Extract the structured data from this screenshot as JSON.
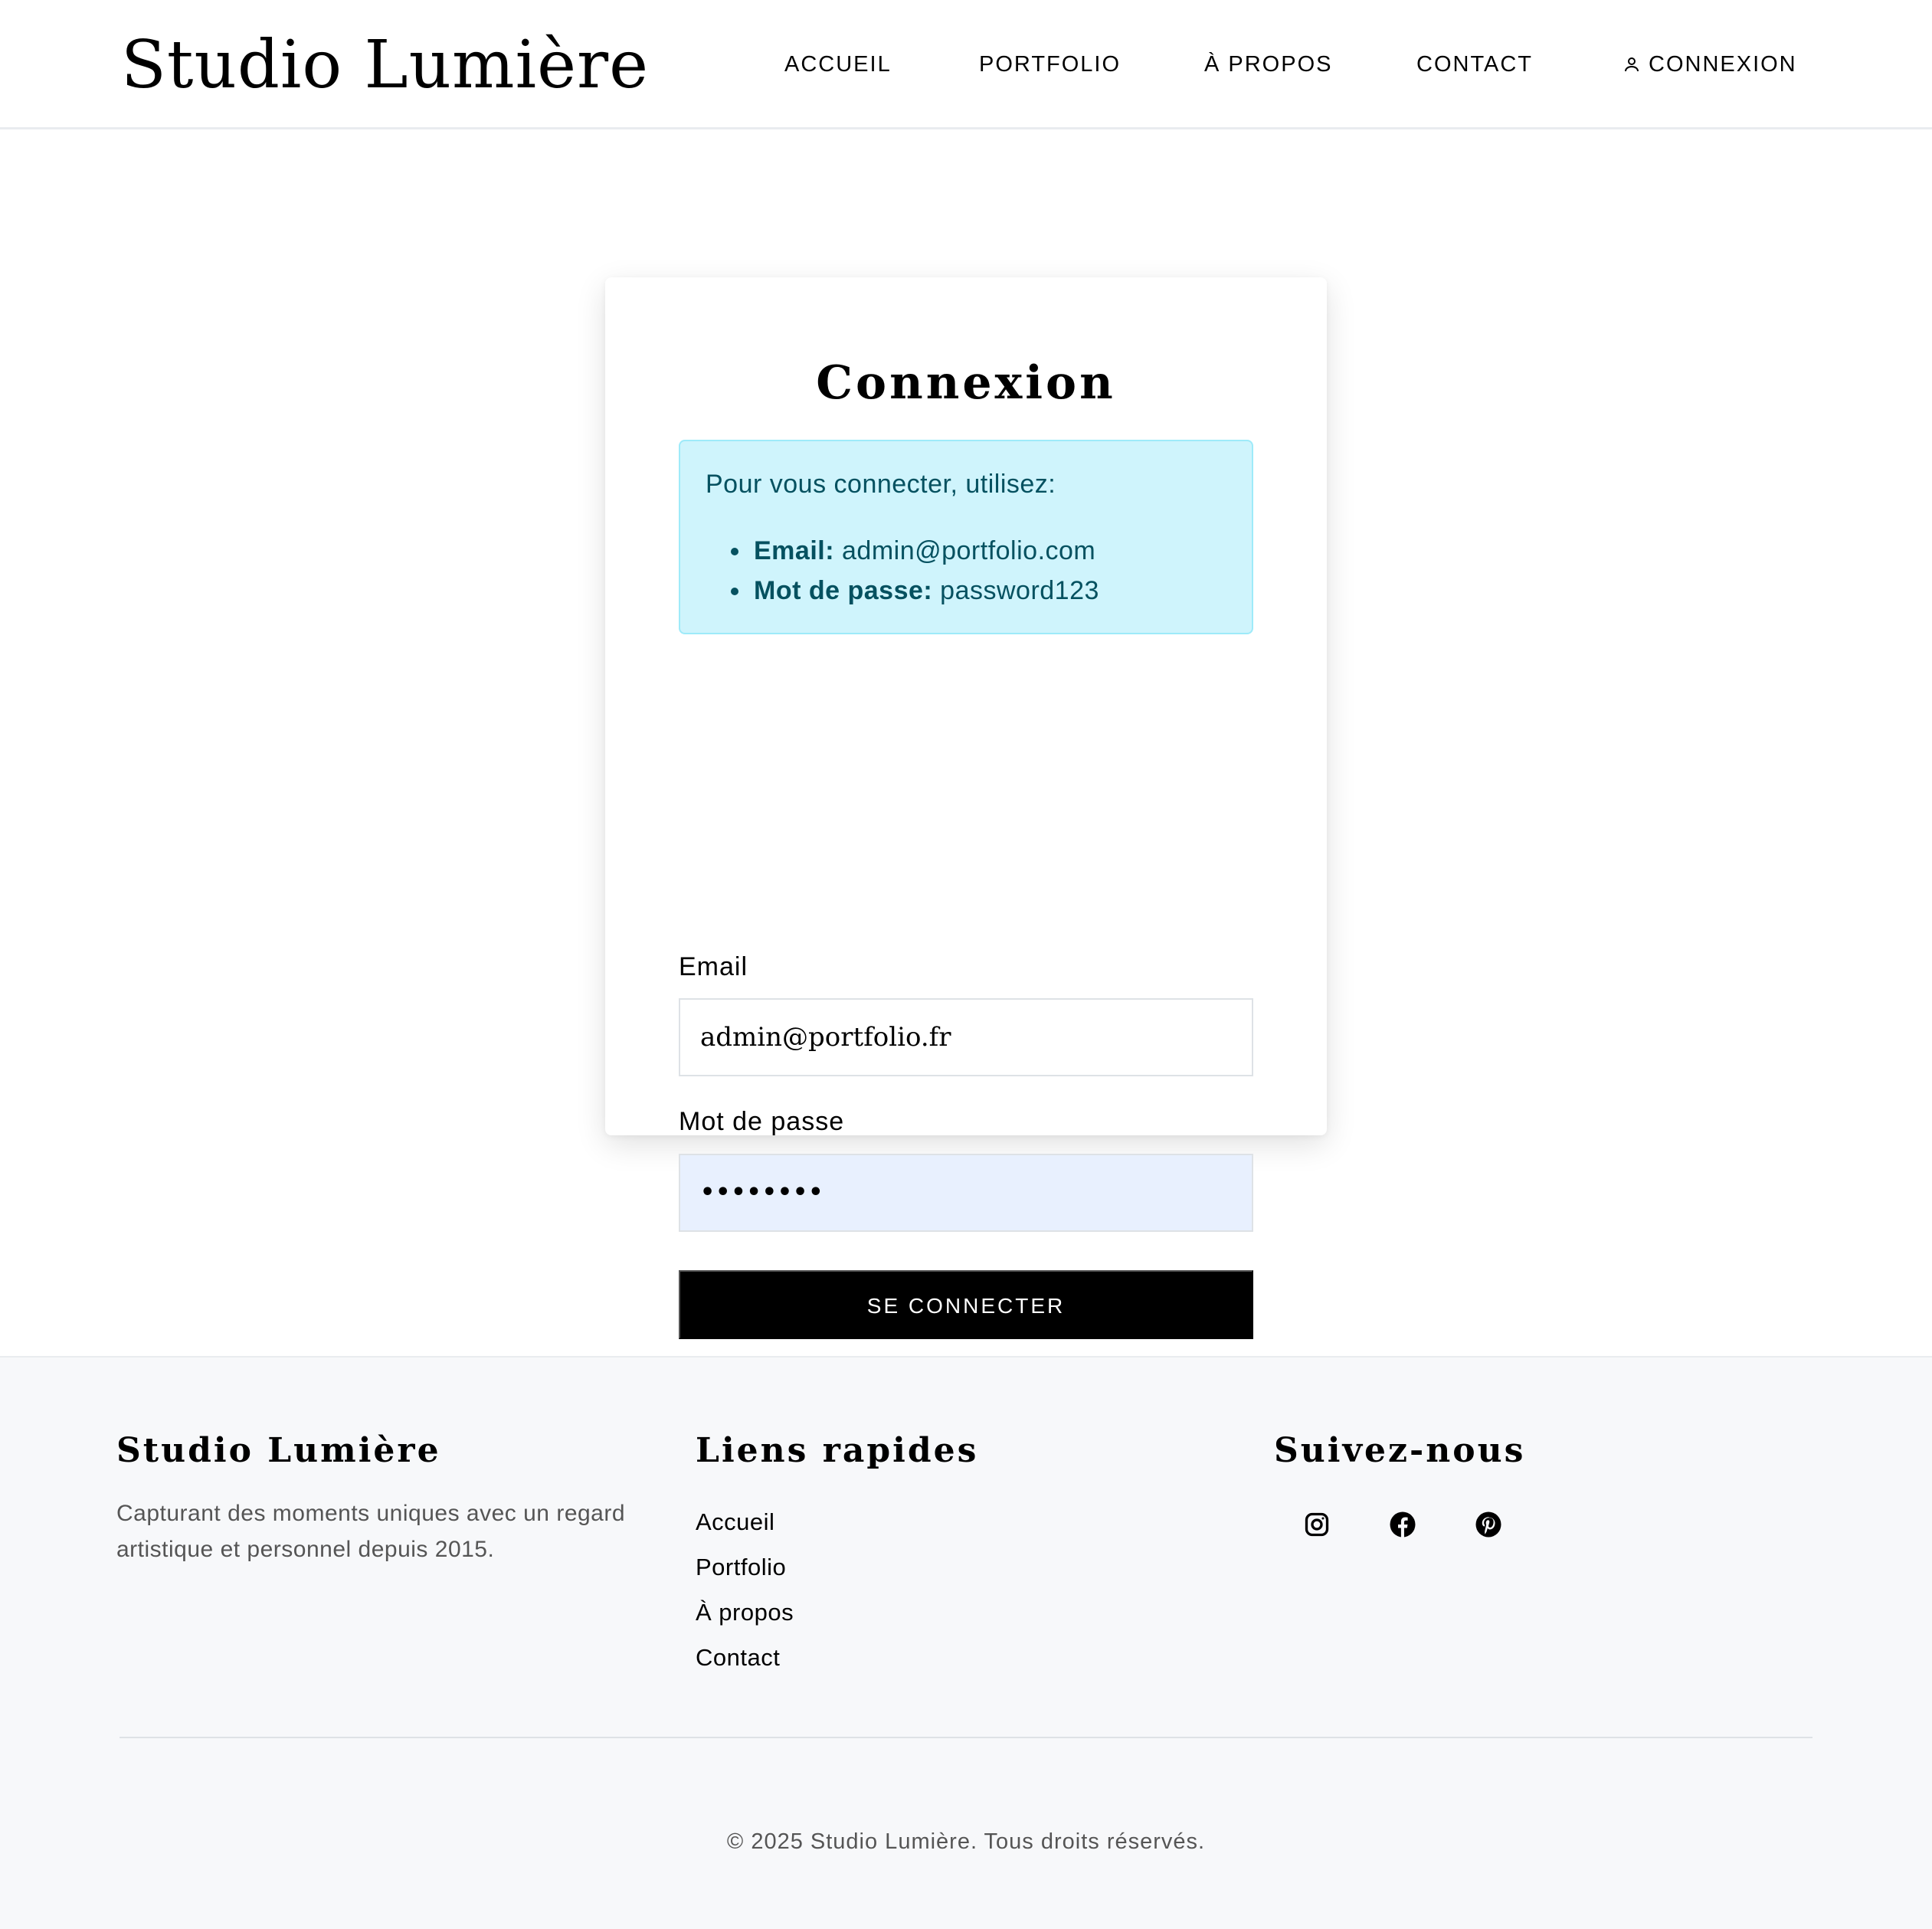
{
  "header": {
    "logo": "Studio Lumière",
    "nav": {
      "accueil": "ACCUEIL",
      "portfolio": "PORTFOLIO",
      "apropos": "À PROPOS",
      "contact": "CONTACT",
      "connexion": "CONNEXION",
      "connexion_icon": "user-icon"
    }
  },
  "login": {
    "title": "Connexion",
    "alert": {
      "intro": "Pour vous connecter, utilisez:",
      "items": [
        {
          "label": "Email:",
          "value": "admin@portfolio.com"
        },
        {
          "label": "Mot de passe:",
          "value": "password123"
        }
      ]
    },
    "email_label": "Email",
    "email_value": "admin@portfolio.fr",
    "password_label": "Mot de passe",
    "password_value": "••••••••",
    "submit_label": "SE CONNECTER"
  },
  "footer": {
    "brand_title": "Studio Lumière",
    "brand_desc": "Capturant des moments uniques avec un regard artistique et personnel depuis 2015.",
    "links_title": "Liens rapides",
    "links": [
      "Accueil",
      "Portfolio",
      "À propos",
      "Contact"
    ],
    "follow_title": "Suivez-nous",
    "social_icons": [
      "instagram-icon",
      "facebook-icon",
      "pinterest-icon"
    ],
    "copyright": "© 2025 Studio Lumière. Tous droits réservés."
  },
  "colors": {
    "alert_bg": "#cff4fc",
    "alert_border": "#9eeaf9",
    "alert_text": "#055160",
    "autofill_bg": "#e8f0fe",
    "button_bg": "#000000",
    "footer_bg": "#f7f8fa"
  }
}
